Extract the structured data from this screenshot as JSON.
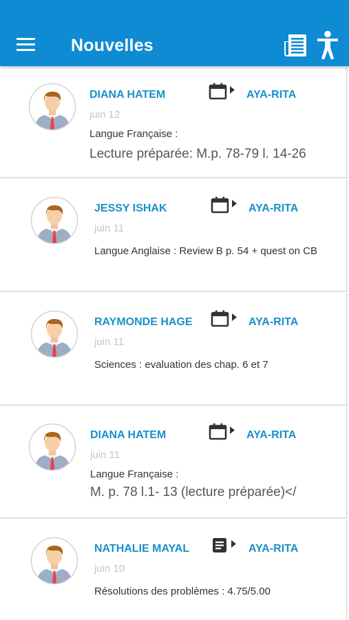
{
  "header": {
    "title": "Nouvelles",
    "menu_icon": "hamburger-menu-icon",
    "news_icon": "newspaper-icon",
    "accessibility_icon": "accessibility-person-icon",
    "background_color": "#0e8bd3"
  },
  "feed": {
    "items": [
      {
        "author": "DIANA HATEM",
        "date": "juin 12",
        "type_icon": "calendar-play-icon",
        "class_name": "AYA-RITA",
        "subject": "Langue Française :",
        "content": "Lecture préparée: M.p. 78-79 l. 14-26"
      },
      {
        "author": "JESSY ISHAK",
        "date": "juin 11",
        "type_icon": "calendar-play-icon",
        "class_name": "AYA-RITA",
        "text": "Langue Anglaise : Review B p. 54 + quest on CB"
      },
      {
        "author": "RAYMONDE HAGE",
        "date": "juin 11",
        "type_icon": "calendar-play-icon",
        "class_name": "AYA-RITA",
        "text": "Sciences : evaluation des chap. 6 et 7"
      },
      {
        "author": "DIANA HATEM",
        "date": "juin 11",
        "type_icon": "calendar-play-icon",
        "class_name": "AYA-RITA",
        "subject": "Langue Française :",
        "content": "M. p. 78 l.1- 13 (lecture préparée)</"
      },
      {
        "author": "NATHALIE MAYAL",
        "date": "juin 10",
        "type_icon": "document-play-icon",
        "class_name": "AYA-RITA",
        "text": "Résolutions des problèmes : 4.75/5.00"
      }
    ]
  }
}
